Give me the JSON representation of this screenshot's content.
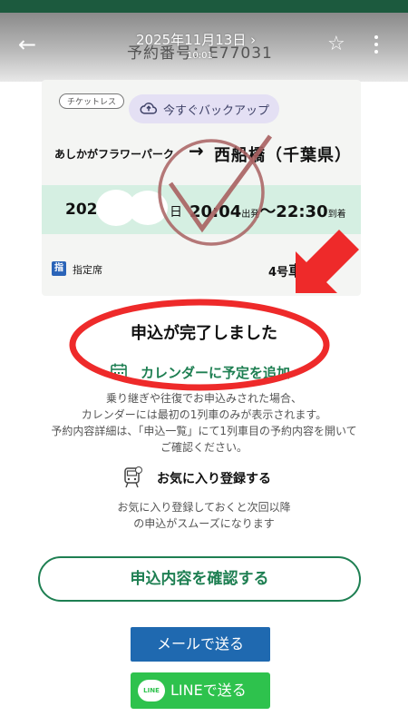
{
  "overlay": {
    "date": "2025年11月13日 ›",
    "time": "10:01"
  },
  "header": {
    "booking_number": "予約番号：E77031",
    "back_icon": "arrow-left-icon",
    "star_icon": "star-outline-icon",
    "more_icon": "more-vert-icon"
  },
  "ticket": {
    "ticketless_tag": "チケットレス",
    "backup_label": "今すぐバックアップ",
    "from": "あしかがフラワーパーク",
    "arrow": "→",
    "to": "西船橋（千葉県）",
    "year_prefix": "202",
    "day_suffix": "日",
    "departure_time": "20:04",
    "departure_label": "出発",
    "separator": "〜",
    "arrival_time": "22:30",
    "arrival_label": "到着",
    "seat_badge": "指",
    "seat_type": "指定席",
    "car_prefix": "4号",
    "car_suffix": "車 7"
  },
  "confirmation": {
    "message": "申込が完了しました",
    "calendar_link": "カレンダーに予定を追加",
    "calendar_note": [
      "乗り継ぎや往復でお申込みされた場合、",
      "カレンダーには最初の1列車のみが表示されます。",
      "予約内容詳細は、「申込一覧」にて1列車目の予約内容を開いて",
      "ご確認ください。"
    ],
    "favorite_label": "お気に入り登録する",
    "favorite_note": [
      "お気に入り登録しておくと次回以降",
      "の申込がスムーズになります"
    ]
  },
  "actions": {
    "confirm": "申込内容を確認する",
    "mail": "メールで送る",
    "line_logo": "LINE",
    "line": "LINEで送る"
  },
  "colors": {
    "brand_green": "#1e7f52",
    "annotation_red": "#ee2a2a",
    "mail_blue": "#1f69b0",
    "line_green": "#2ec24d"
  }
}
